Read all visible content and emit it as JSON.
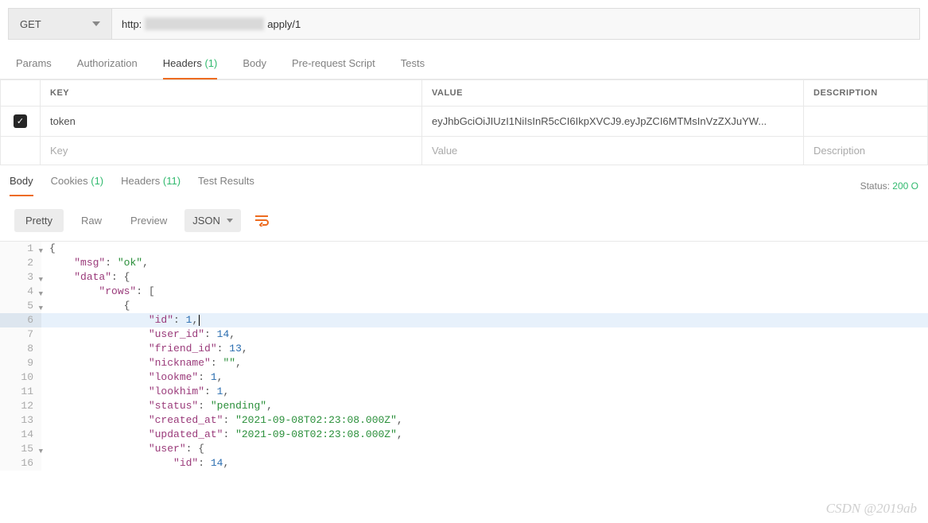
{
  "request": {
    "method": "GET",
    "url_prefix": "http:",
    "url_suffix": "apply/1"
  },
  "req_tabs": [
    {
      "label": "Params"
    },
    {
      "label": "Authorization"
    },
    {
      "label": "Headers",
      "count": "(1)"
    },
    {
      "label": "Body"
    },
    {
      "label": "Pre-request Script"
    },
    {
      "label": "Tests"
    }
  ],
  "headers_table": {
    "cols": {
      "key": "KEY",
      "value": "VALUE",
      "desc": "DESCRIPTION"
    },
    "rows": [
      {
        "checked": true,
        "key": "token",
        "value": "eyJhbGciOiJIUzI1NiIsInR5cCI6IkpXVCJ9.eyJpZCI6MTMsInVzZXJuYW...",
        "desc": ""
      }
    ],
    "placeholders": {
      "key": "Key",
      "value": "Value",
      "desc": "Description"
    }
  },
  "resp_tabs": [
    {
      "label": "Body"
    },
    {
      "label": "Cookies",
      "count": "(1)"
    },
    {
      "label": "Headers",
      "count": "(11)"
    },
    {
      "label": "Test Results"
    }
  ],
  "status": {
    "label": "Status:",
    "code": "200 O"
  },
  "view": {
    "pretty": "Pretty",
    "raw": "Raw",
    "preview": "Preview",
    "format": "JSON"
  },
  "code": {
    "cursor_line": 6,
    "lines": [
      {
        "n": 1,
        "fold": true,
        "indent": 0,
        "tokens": [
          {
            "t": "punc",
            "v": "{"
          }
        ]
      },
      {
        "n": 2,
        "indent": 1,
        "tokens": [
          {
            "t": "key",
            "v": "\"msg\""
          },
          {
            "t": "punc",
            "v": ": "
          },
          {
            "t": "str",
            "v": "\"ok\""
          },
          {
            "t": "punc",
            "v": ","
          }
        ]
      },
      {
        "n": 3,
        "fold": true,
        "indent": 1,
        "tokens": [
          {
            "t": "key",
            "v": "\"data\""
          },
          {
            "t": "punc",
            "v": ": {"
          }
        ]
      },
      {
        "n": 4,
        "fold": true,
        "indent": 2,
        "tokens": [
          {
            "t": "key",
            "v": "\"rows\""
          },
          {
            "t": "punc",
            "v": ": ["
          }
        ]
      },
      {
        "n": 5,
        "fold": true,
        "indent": 3,
        "tokens": [
          {
            "t": "punc",
            "v": "{"
          }
        ]
      },
      {
        "n": 6,
        "indent": 4,
        "tokens": [
          {
            "t": "key",
            "v": "\"id\""
          },
          {
            "t": "punc",
            "v": ": "
          },
          {
            "t": "num",
            "v": "1"
          },
          {
            "t": "punc",
            "v": ","
          }
        ]
      },
      {
        "n": 7,
        "indent": 4,
        "tokens": [
          {
            "t": "key",
            "v": "\"user_id\""
          },
          {
            "t": "punc",
            "v": ": "
          },
          {
            "t": "num",
            "v": "14"
          },
          {
            "t": "punc",
            "v": ","
          }
        ]
      },
      {
        "n": 8,
        "indent": 4,
        "tokens": [
          {
            "t": "key",
            "v": "\"friend_id\""
          },
          {
            "t": "punc",
            "v": ": "
          },
          {
            "t": "num",
            "v": "13"
          },
          {
            "t": "punc",
            "v": ","
          }
        ]
      },
      {
        "n": 9,
        "indent": 4,
        "tokens": [
          {
            "t": "key",
            "v": "\"nickname\""
          },
          {
            "t": "punc",
            "v": ": "
          },
          {
            "t": "str",
            "v": "\"\""
          },
          {
            "t": "punc",
            "v": ","
          }
        ]
      },
      {
        "n": 10,
        "indent": 4,
        "tokens": [
          {
            "t": "key",
            "v": "\"lookme\""
          },
          {
            "t": "punc",
            "v": ": "
          },
          {
            "t": "num",
            "v": "1"
          },
          {
            "t": "punc",
            "v": ","
          }
        ]
      },
      {
        "n": 11,
        "indent": 4,
        "tokens": [
          {
            "t": "key",
            "v": "\"lookhim\""
          },
          {
            "t": "punc",
            "v": ": "
          },
          {
            "t": "num",
            "v": "1"
          },
          {
            "t": "punc",
            "v": ","
          }
        ]
      },
      {
        "n": 12,
        "indent": 4,
        "tokens": [
          {
            "t": "key",
            "v": "\"status\""
          },
          {
            "t": "punc",
            "v": ": "
          },
          {
            "t": "str",
            "v": "\"pending\""
          },
          {
            "t": "punc",
            "v": ","
          }
        ]
      },
      {
        "n": 13,
        "indent": 4,
        "tokens": [
          {
            "t": "key",
            "v": "\"created_at\""
          },
          {
            "t": "punc",
            "v": ": "
          },
          {
            "t": "str",
            "v": "\"2021-09-08T02:23:08.000Z\""
          },
          {
            "t": "punc",
            "v": ","
          }
        ]
      },
      {
        "n": 14,
        "indent": 4,
        "tokens": [
          {
            "t": "key",
            "v": "\"updated_at\""
          },
          {
            "t": "punc",
            "v": ": "
          },
          {
            "t": "str",
            "v": "\"2021-09-08T02:23:08.000Z\""
          },
          {
            "t": "punc",
            "v": ","
          }
        ]
      },
      {
        "n": 15,
        "fold": true,
        "indent": 4,
        "tokens": [
          {
            "t": "key",
            "v": "\"user\""
          },
          {
            "t": "punc",
            "v": ": {"
          }
        ]
      },
      {
        "n": 16,
        "indent": 5,
        "tokens": [
          {
            "t": "key",
            "v": "\"id\""
          },
          {
            "t": "punc",
            "v": ": "
          },
          {
            "t": "num",
            "v": "14"
          },
          {
            "t": "punc",
            "v": ","
          }
        ]
      }
    ]
  },
  "watermark": "CSDN @2019ab"
}
